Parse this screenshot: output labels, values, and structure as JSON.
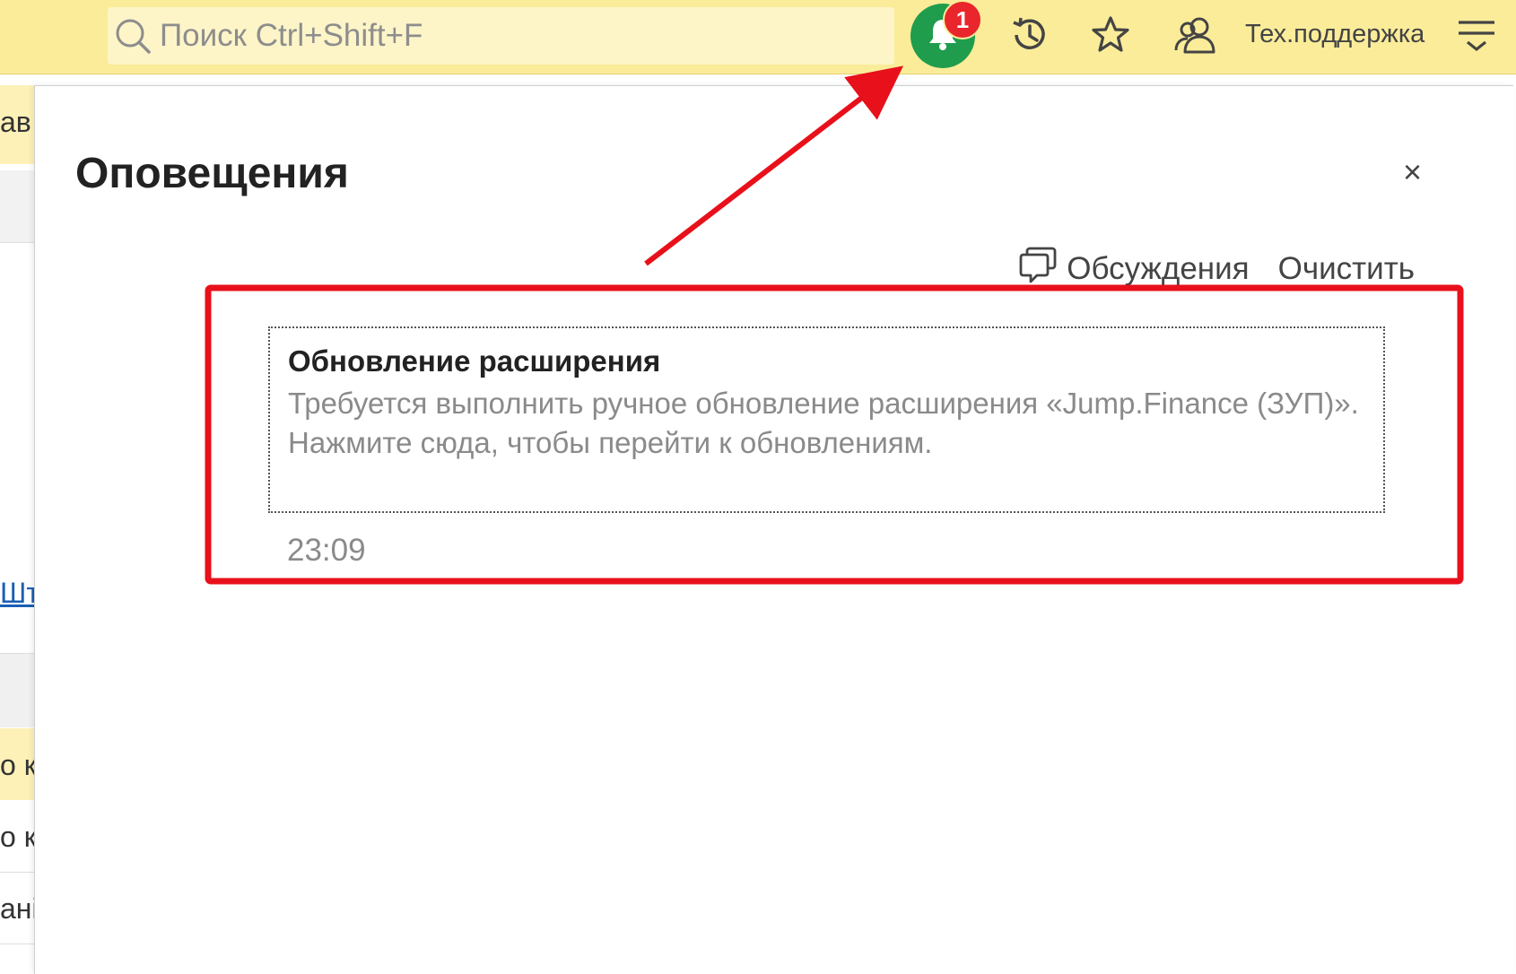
{
  "toolbar": {
    "search_placeholder": "Поиск Ctrl+Shift+F",
    "notifications_count": "1",
    "support_label": "Тех.поддержка"
  },
  "left_app": {
    "fragment_1": "ав",
    "link_fragment": "Шт",
    "row_fragment_1": "о к",
    "row_fragment_2": "о к",
    "row_fragment_3": "ані"
  },
  "panel": {
    "title": "Оповещения",
    "close_label": "×",
    "discussions_label": "Обсуждения",
    "clear_label": "Очистить",
    "notification": {
      "title": "Обновление расширения",
      "text_line_1": "Требуется выполнить ручное обновление расширения «Jump.Finance (ЗУП)».",
      "text_line_2": "Нажмите сюда, чтобы перейти к обновлениям.",
      "time": "23:09"
    }
  },
  "colors": {
    "toolbar_bg": "#fbec9a",
    "bell_green": "#1f9d4c",
    "badge_red": "#e8262b",
    "annotation_red": "#e8101a"
  }
}
